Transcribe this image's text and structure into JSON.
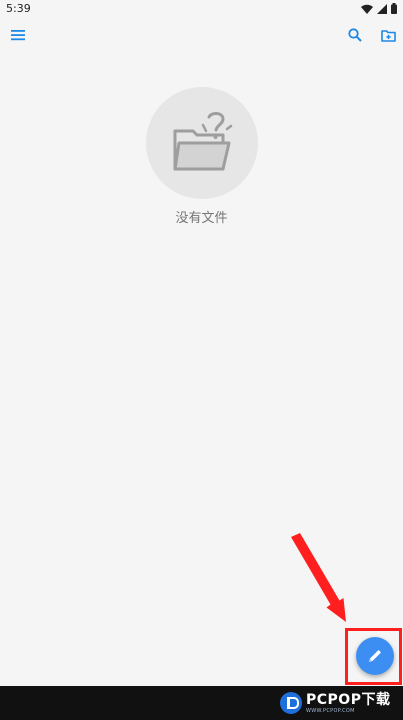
{
  "status_bar": {
    "time": "5:39",
    "icons": [
      "wifi-icon",
      "signal-icon",
      "battery-icon"
    ]
  },
  "app_bar": {
    "icons": [
      "menu-icon",
      "search-icon",
      "new-folder-icon"
    ]
  },
  "empty_state": {
    "icon": "empty-folder-question-icon",
    "text": "没有文件"
  },
  "fab": {
    "icon": "compose-pen-icon"
  },
  "annotation": {
    "color": "#ff1f1f"
  },
  "watermark": {
    "text": "PCPOP下载",
    "sub": "WWW.PCPOP.COM"
  },
  "colors": {
    "background": "#f5f5f5",
    "accent": "#3d8ef2",
    "icon_blue": "#1e88e5",
    "annotation_red": "#ff1f1f"
  }
}
